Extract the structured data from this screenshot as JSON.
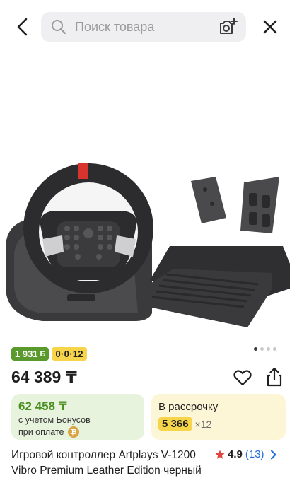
{
  "header": {
    "search_placeholder": "Поиск товара",
    "icons": [
      "back-arrow-icon",
      "search-icon",
      "camera-icon",
      "close-icon"
    ]
  },
  "gallery": {
    "image_count": 4,
    "active_index": 0
  },
  "badges": {
    "bonus": "1 931",
    "bonus_glyph": "Б",
    "installment": "0·0·12"
  },
  "price": "64 389 ₸",
  "bonus_card": {
    "price": "62 458 ₸",
    "line1": "с учетом Бонусов",
    "line2": "при оплате",
    "coin": "₿"
  },
  "installment_card": {
    "title": "В рассрочку",
    "amount": "5 366",
    "term": "×12"
  },
  "product": {
    "title": "Игровой контроллер Artplays V-1200 Vibro Premium Leather Edition черный",
    "rating": "4.9",
    "reviews": "(13)"
  },
  "colors": {
    "accent_green": "#5a9a2c",
    "bonus_text": "#4a8f22",
    "bonus_bg": "#e7f3dc",
    "install_yellow": "#f7d54a",
    "install_bg": "#fdf6d6",
    "link_blue": "#1e6fd9",
    "star_red": "#e0463d"
  }
}
